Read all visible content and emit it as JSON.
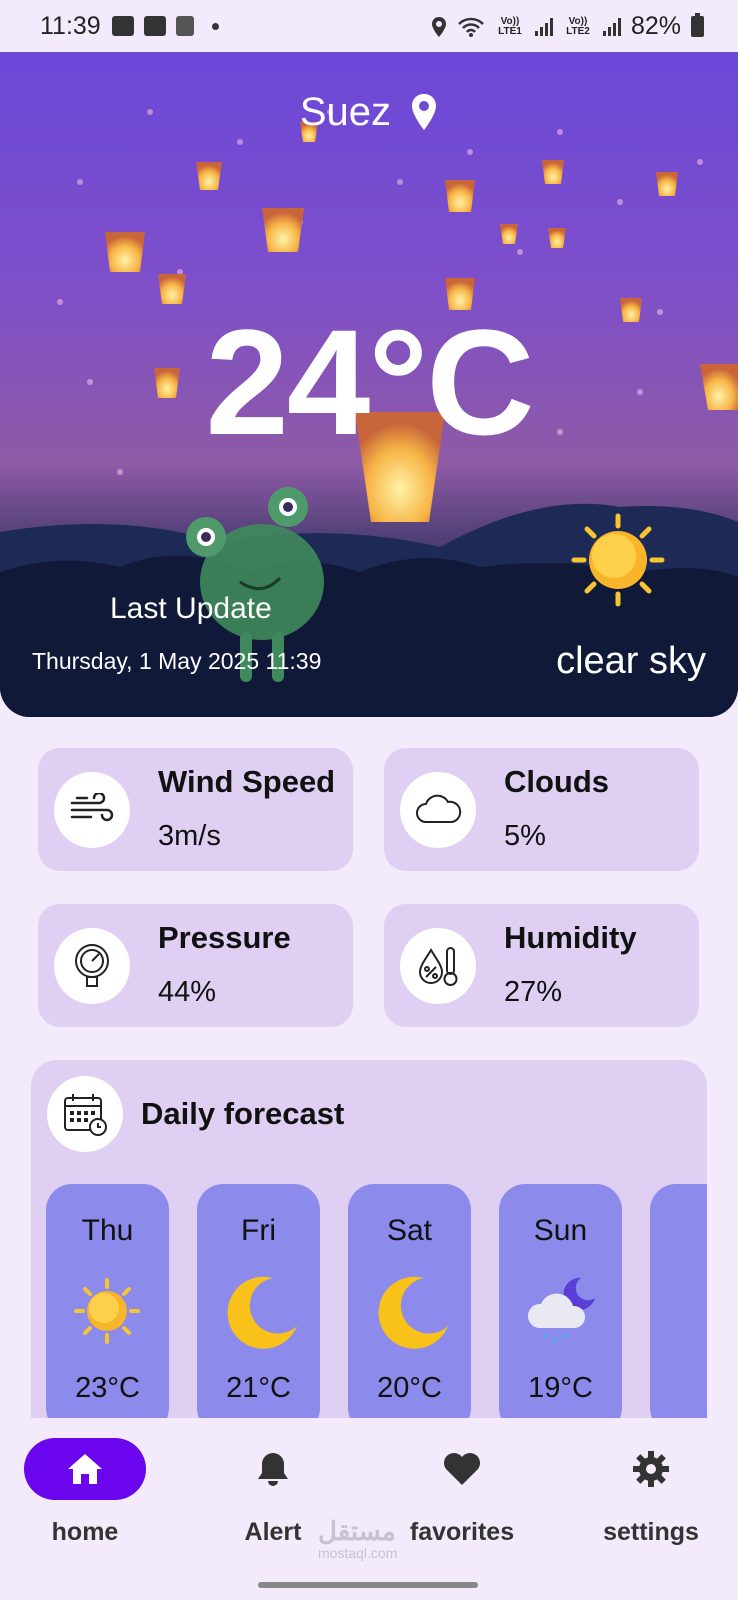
{
  "status_bar": {
    "time": "11:39",
    "network_1": "Vo)) LTE1",
    "network_2": "Vo)) LTE2",
    "battery": "82%"
  },
  "hero": {
    "city": "Suez",
    "temperature": "24°C",
    "last_update_label": "Last Update",
    "last_update_value": "Thursday, 1 May 2025 11:39",
    "description": "clear sky"
  },
  "stats": [
    {
      "title": "Wind Speed",
      "value": "3m/s",
      "icon": "wind-icon"
    },
    {
      "title": "Clouds",
      "value": "5%",
      "icon": "cloud-icon"
    },
    {
      "title": "Pressure",
      "value": "44%",
      "icon": "pressure-gauge-icon"
    },
    {
      "title": "Humidity",
      "value": "27%",
      "icon": "humidity-icon"
    }
  ],
  "daily": {
    "title": "Daily forecast",
    "days": [
      {
        "day": "Thu",
        "temp": "23°C",
        "icon": "sun-icon"
      },
      {
        "day": "Fri",
        "temp": "21°C",
        "icon": "moon-icon"
      },
      {
        "day": "Sat",
        "temp": "20°C",
        "icon": "moon-icon"
      },
      {
        "day": "Sun",
        "temp": "19°C",
        "icon": "cloudy-night-icon"
      }
    ]
  },
  "nav": {
    "home": "home",
    "alert": "Alert",
    "favorites": "favorites",
    "settings": "settings"
  },
  "watermark": {
    "arabic": "مستقل",
    "latin": "mostaql.com"
  },
  "colors": {
    "accent": "#6b05ee",
    "card": "#dfd0f3",
    "forecast_card": "#8c8aea",
    "background": "#f3ebfb"
  }
}
